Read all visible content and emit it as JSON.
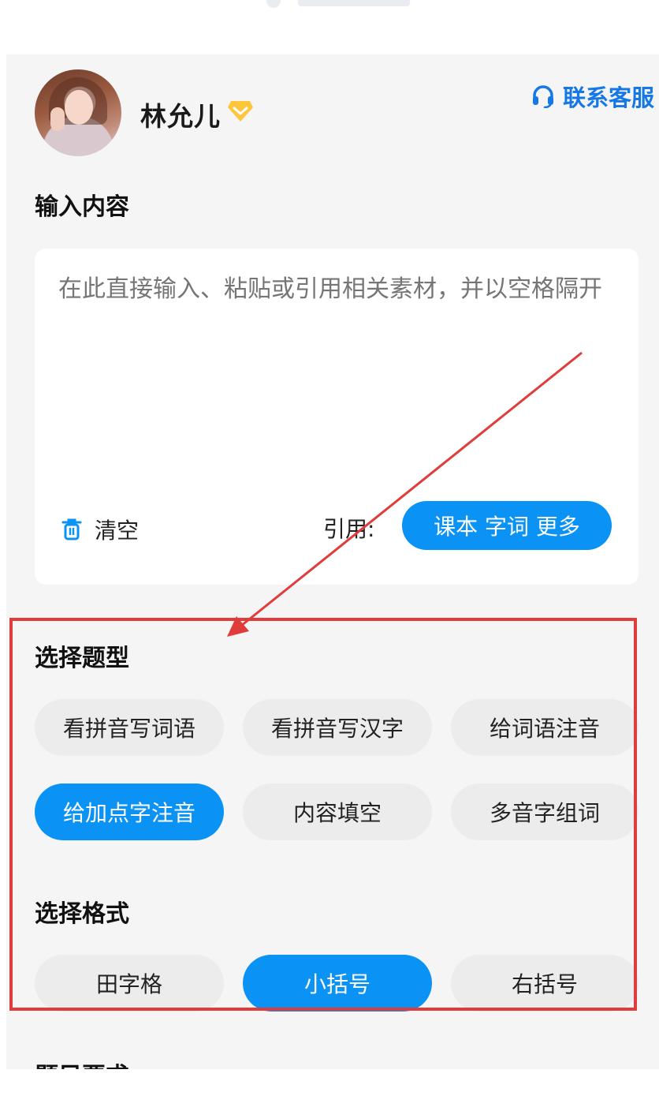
{
  "user": {
    "name": "林允儿",
    "vip_icon": "diamond-icon"
  },
  "header": {
    "contact_label": "联系客服",
    "contact_icon": "headset-icon"
  },
  "input_section": {
    "title": "输入内容",
    "placeholder": "在此直接输入、粘贴或引用相关素材，并以空格隔开",
    "clear_label": "清空",
    "clear_icon": "trash-icon",
    "cite_label": "引用:",
    "cite_button": "课本 字词 更多"
  },
  "question_type": {
    "title": "选择题型",
    "options": [
      {
        "label": "看拼音写词语",
        "selected": false
      },
      {
        "label": "看拼音写汉字",
        "selected": false
      },
      {
        "label": "给词语注音",
        "selected": false
      },
      {
        "label": "给加点字注音",
        "selected": true
      },
      {
        "label": "内容填空",
        "selected": false
      },
      {
        "label": "多音字组词",
        "selected": false
      }
    ]
  },
  "format": {
    "title": "选择格式",
    "options": [
      {
        "label": "田字格",
        "selected": false
      },
      {
        "label": "小括号",
        "selected": true
      },
      {
        "label": "右括号",
        "selected": false
      }
    ]
  },
  "next_section": {
    "title": "题目要求"
  },
  "colors": {
    "accent": "#0a92f5",
    "annotation": "#e03c3c",
    "panel_bg": "#f5f5f5"
  }
}
